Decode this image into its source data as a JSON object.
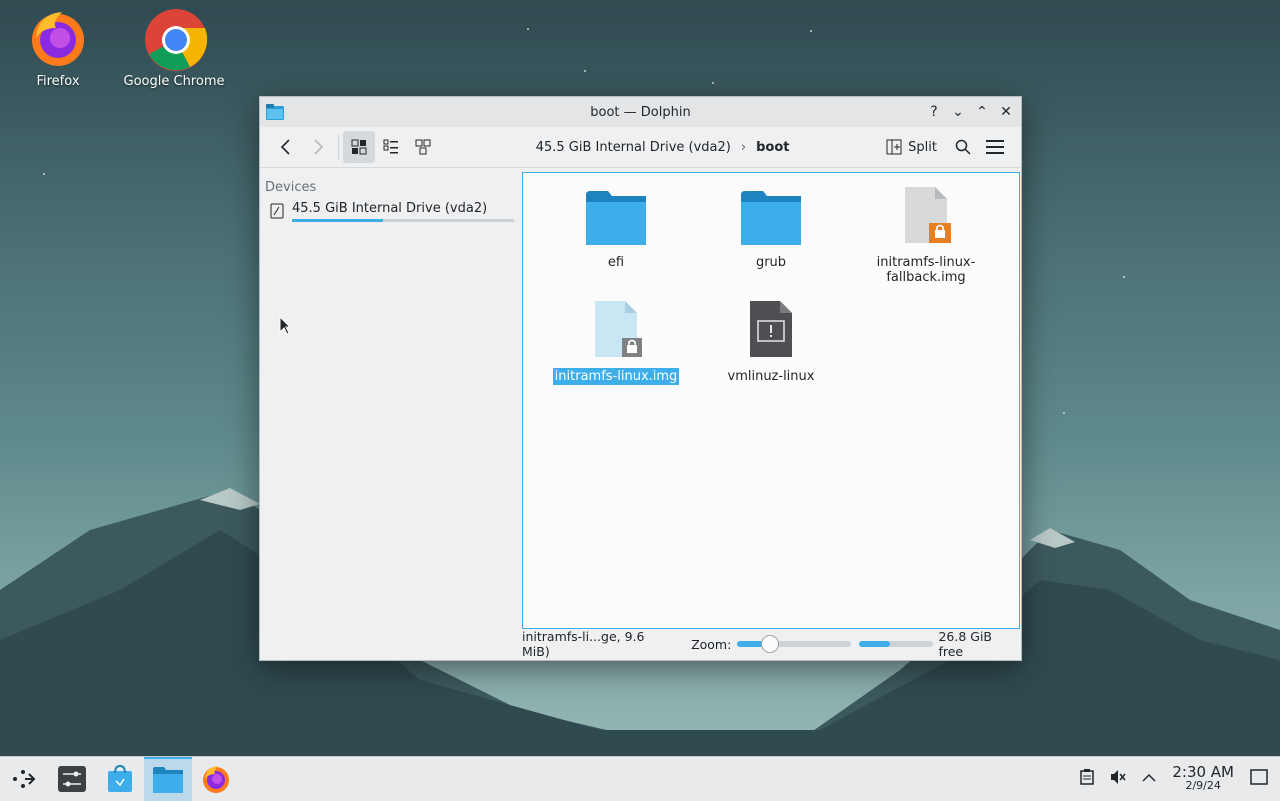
{
  "desktop": {
    "icons": [
      {
        "label": "Firefox"
      },
      {
        "label": "Google Chrome"
      }
    ]
  },
  "window": {
    "title": "boot — Dolphin",
    "toolbar": {
      "breadcrumb": [
        "45.5 GiB Internal Drive (vda2)",
        "boot"
      ],
      "split_label": "Split"
    },
    "sidebar": {
      "section_title": "Devices",
      "devices": [
        {
          "label": "45.5 GiB Internal Drive (vda2)",
          "usage_fraction": 0.41
        }
      ]
    },
    "files": [
      {
        "name": "efi",
        "type": "folder"
      },
      {
        "name": "grub",
        "type": "folder"
      },
      {
        "name": "initramfs-linux-fallback.img",
        "type": "locked-file"
      },
      {
        "name": "initramfs-linux.img",
        "type": "locked-file",
        "selected": true
      },
      {
        "name": "vmlinuz-linux",
        "type": "executable"
      }
    ],
    "status": {
      "selection_info": "initramfs-li...ge, 9.6 MiB)",
      "zoom_label": "Zoom:",
      "zoom_fraction": 0.28,
      "disk_used_fraction": 0.41,
      "free_space": "26.8 GiB free"
    }
  },
  "taskbar": {
    "clock_time": "2:30 AM",
    "clock_date": "2/9/24"
  },
  "colors": {
    "accent": "#3daee9",
    "folder": "#2a9fd8"
  }
}
